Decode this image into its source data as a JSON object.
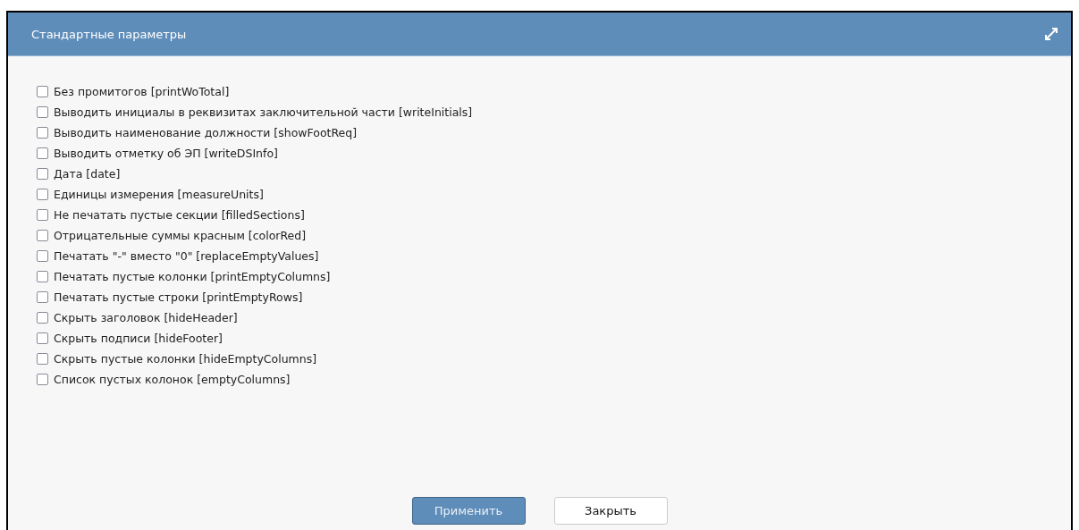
{
  "dialog": {
    "title": "Стандартные параметры"
  },
  "options": [
    {
      "label": "Без промитогов [printWoTotal]",
      "checked": false
    },
    {
      "label": "Выводить инициалы в реквизитах заключительной части [writeInitials]",
      "checked": false
    },
    {
      "label": "Выводить наименование должности [showFootReq]",
      "checked": false
    },
    {
      "label": "Выводить отметку об ЭП [writeDSInfo]",
      "checked": false
    },
    {
      "label": "Дата [date]",
      "checked": false
    },
    {
      "label": "Единицы измерения [measureUnits]",
      "checked": false
    },
    {
      "label": "Не печатать пустые секции [filledSections]",
      "checked": false
    },
    {
      "label": "Отрицательные суммы красным [colorRed]",
      "checked": false
    },
    {
      "label": "Печатать \"-\" вместо \"0\" [replaceEmptyValues]",
      "checked": false
    },
    {
      "label": "Печатать пустые колонки [printEmptyColumns]",
      "checked": false
    },
    {
      "label": "Печатать пустые строки [printEmptyRows]",
      "checked": false
    },
    {
      "label": "Скрыть заголовок [hideHeader]",
      "checked": false
    },
    {
      "label": "Скрыть подписи [hideFooter]",
      "checked": false
    },
    {
      "label": "Скрыть пустые колонки [hideEmptyColumns]",
      "checked": false
    },
    {
      "label": "Список пустых колонок [emptyColumns]",
      "checked": false
    }
  ],
  "buttons": [
    {
      "label": "Применить",
      "kind": "primary"
    },
    {
      "label": "Закрыть",
      "kind": "secondary"
    }
  ]
}
